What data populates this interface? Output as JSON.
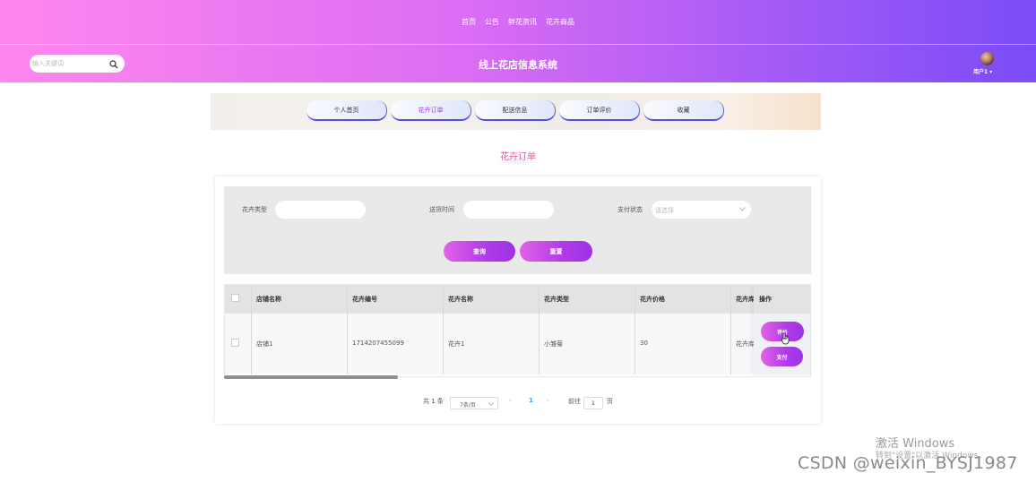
{
  "top_nav": [
    "首页",
    "公告",
    "鲜花资讯",
    "花卉商品"
  ],
  "search": {
    "placeholder": "输入关键词"
  },
  "site_title": "线上花店信息系统",
  "user": {
    "label": "用户1 ▾"
  },
  "tabs": [
    {
      "label": "个人首页",
      "active": false
    },
    {
      "label": "花卉订单",
      "active": true
    },
    {
      "label": "配送信息",
      "active": false
    },
    {
      "label": "订单评价",
      "active": false
    },
    {
      "label": "收藏",
      "active": false
    }
  ],
  "page_title": "花卉订单",
  "filters": {
    "type_label": "花卉类型",
    "time_label": "送货时间",
    "pay_label": "支付状态",
    "pay_placeholder": "请选择",
    "query_button": "查询",
    "reset_button": "重置"
  },
  "table": {
    "columns": [
      "店铺名称",
      "花卉编号",
      "花卉名称",
      "花卉类型",
      "花卉价格",
      "花卉库",
      "操作"
    ],
    "rows": [
      {
        "shop": "店铺1",
        "code": "1714207455099",
        "name": "花卉1",
        "type": "小雏菊",
        "price": "30",
        "stock": "花卉库"
      }
    ],
    "actions": {
      "review": "评价",
      "pay": "支付"
    }
  },
  "pagination": {
    "total": "共 1 条",
    "page_size": "7条/页",
    "prev": "‹",
    "current": "1",
    "next": "›",
    "goto_label": "前往",
    "goto_value": "1",
    "page_unit": "页"
  },
  "watermarks": {
    "activate_title": "激活 Windows",
    "activate_sub": "转到\"设置\"以激活 Windows。",
    "csdn": "CSDN @weixin_BYSJ1987"
  },
  "colors": {
    "header_gradient_start": "#fe87ee",
    "header_gradient_end": "#7b4cf7",
    "button_purple": "#b13ae8",
    "title_pink": "#e05ea1"
  }
}
